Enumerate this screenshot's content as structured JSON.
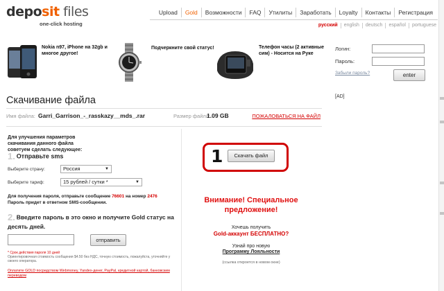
{
  "logo": {
    "part_a": "depo",
    "part_b": "sit",
    "part_c": " files",
    "tagline": "one-click hosting"
  },
  "nav": [
    "Upload",
    "Gold",
    "Возможности",
    "FAQ",
    "Утилиты",
    "Заработать",
    "Loyalty",
    "Контакты",
    "Регистрация"
  ],
  "languages": [
    "русский",
    "english",
    "deutsch",
    "español",
    "portuguese"
  ],
  "promos": [
    {
      "text": "Nokia n97, iPhone на 32gb и многое другое!",
      "icon": "phones-icon"
    },
    {
      "text": "Подчеркните свой статус!",
      "icon": "watch-icon"
    },
    {
      "text": "Телефон часы (2 активные сим) - Носится на Руке",
      "icon": "phone-watch-icon"
    }
  ],
  "login": {
    "login_label": "Логин:",
    "password_label": "Пароль:",
    "forgot": "Забыли пароль?",
    "enter": "enter"
  },
  "ad": "[AD]",
  "page_title": "Скачивание файла",
  "file": {
    "name_label": "Имя файла:",
    "name": "Garri_Garrison_-_rasskazy__mds_.rar",
    "size_label": "Размер файла:",
    "size": "1.09 GB",
    "complain": "ПОЖАЛОВАТЬСЯ НА ФАЙЛ"
  },
  "sms": {
    "advice": "Для улучшения параметров скачивания данного файла советуем сделать следующее:",
    "step1_num": "1.",
    "step1_title": "Отправьте sms",
    "country_label": "Выберите страну:",
    "country_value": "Россия",
    "tariff_label": "Выберите тариф:",
    "tariff_value": "15 рублей / сутки *",
    "info_a": "Для получения пароля, отправьте сообщение",
    "code": "76601",
    "info_b": "на номер",
    "number": "2476",
    "info_c": "Пароль придет в ответном SMS-сообщении.",
    "step2_num": "2.",
    "step2_title": "Введите пароль в это окно и получите Gold статус на десять дней.",
    "send": "отправить",
    "fine_red": "* Срок действия пароля 10 дней",
    "fine_1": "Ориентировочная стоимость сообщения $4.50 без НДС, точную стоимость, пожалуйста, уточняйте у своего оператора.",
    "gold_link": "Оплатите GOLD посредством Webmoney, Yandex-денег, PayPal, кредитной картой, банковским переводом"
  },
  "download": {
    "num": "1",
    "label": "Скачать файл"
  },
  "offer": {
    "title": "Внимание! Специальное предложение!",
    "want": "Хочешь получить",
    "gold": "Gold-аккаунт БЕСПЛАТНО?",
    "learn": "Узнай про новую",
    "program": "Программу Лояльности",
    "note": "(ссылка откроется в новом окне)"
  }
}
